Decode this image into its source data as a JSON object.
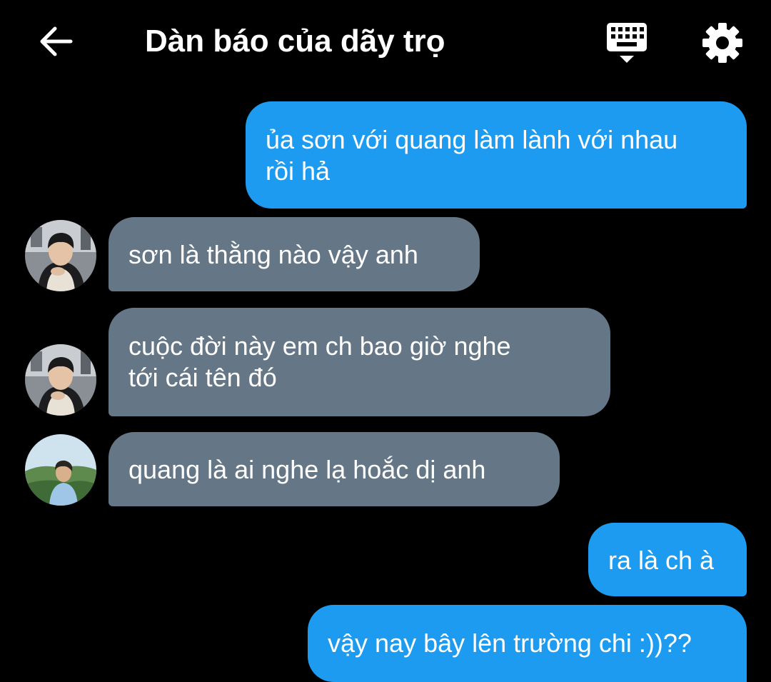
{
  "header": {
    "title": "Dàn báo của dãy trọ",
    "back_icon": "arrow-left-icon",
    "keyboard_icon": "keyboard-icon",
    "settings_icon": "gear-icon"
  },
  "messages": [
    {
      "side": "outgoing",
      "lines": [
        "ủa sơn với quang làm lành với nhau",
        "rồi hả"
      ]
    },
    {
      "side": "incoming",
      "avatar": "avatar-1",
      "lines": [
        "sơn là thằng nào vậy anh"
      ]
    },
    {
      "side": "incoming",
      "avatar": "avatar-1",
      "lines": [
        "cuộc đời này em ch bao giờ nghe",
        "tới cái tên đó"
      ]
    },
    {
      "side": "incoming",
      "avatar": "avatar-2",
      "lines": [
        "quang là ai nghe lạ hoắc dị anh"
      ]
    },
    {
      "side": "outgoing",
      "lines": [
        "ra là ch à"
      ]
    },
    {
      "side": "outgoing",
      "lines": [
        "vậy nay bây lên trường chi :))??"
      ]
    }
  ],
  "colors": {
    "background": "#000000",
    "outgoing_bubble": "#1d9bf0",
    "incoming_bubble": "#657786",
    "text": "#ffffff"
  }
}
